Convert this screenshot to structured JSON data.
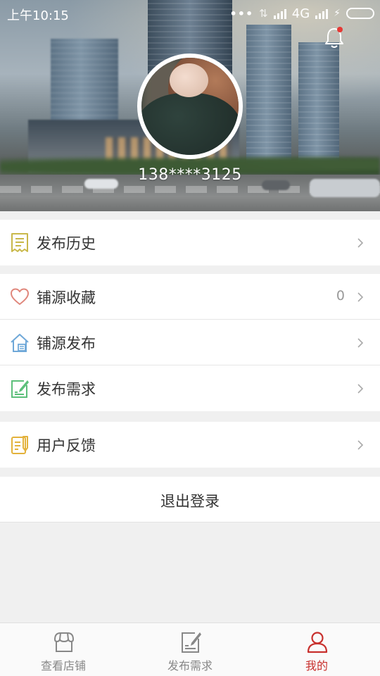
{
  "status_bar": {
    "time": "上午10:15",
    "network": "4G"
  },
  "profile": {
    "phone": "138****3125",
    "notification_dot_color": "#e53935"
  },
  "menu_groups": [
    {
      "items": [
        {
          "label": "发布历史",
          "icon": "receipt-icon",
          "icon_color": "#c9b84a"
        }
      ]
    },
    {
      "items": [
        {
          "label": "铺源收藏",
          "icon": "heart-icon",
          "icon_color": "#e0877c",
          "count": "0"
        },
        {
          "label": "铺源发布",
          "icon": "house-icon",
          "icon_color": "#6fa8d8"
        },
        {
          "label": "发布需求",
          "icon": "edit-note-icon",
          "icon_color": "#5cbf7a"
        }
      ]
    },
    {
      "items": [
        {
          "label": "用户反馈",
          "icon": "feedback-icon",
          "icon_color": "#e3b23c"
        }
      ]
    }
  ],
  "logout_label": "退出登录",
  "tabbar": {
    "tabs": [
      {
        "label": "查看店铺",
        "icon": "shop-icon",
        "active": false
      },
      {
        "label": "发布需求",
        "icon": "edit-note-icon",
        "active": false
      },
      {
        "label": "我的",
        "icon": "user-icon",
        "active": true
      }
    ],
    "active_color": "#c8302d",
    "inactive_color": "#888888"
  }
}
